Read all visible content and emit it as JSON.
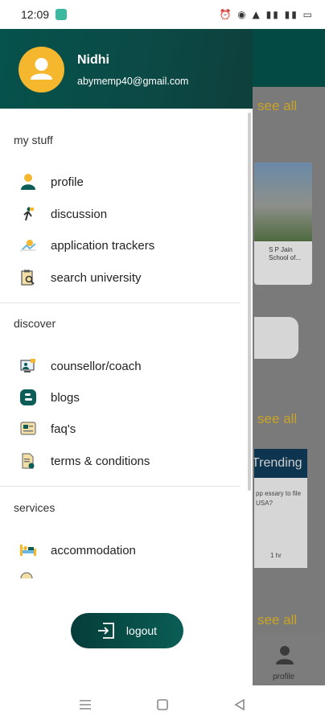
{
  "status_bar": {
    "time": "12:09",
    "right_icons": "⏰ ◉ ▲ ▮▮ ▮▮ ▭"
  },
  "background": {
    "see_all_label": "see all",
    "card_text": "S P Jain School of...",
    "trending_label": "Trending",
    "post_text": "pp essary to file USA?",
    "post_time": "1 hr",
    "nav_profile_label": "profile"
  },
  "user": {
    "name": "Nidhi",
    "email": "abymemp40@gmail.com"
  },
  "sections": {
    "my_stuff": "my stuff",
    "discover": "discover",
    "services": "services"
  },
  "menu": {
    "profile": "profile",
    "discussion": "discussion",
    "application_trackers": "application trackers",
    "search_university": "search university",
    "counsellor_coach": "counsellor/coach",
    "blogs": "blogs",
    "faqs": "faq's",
    "terms_conditions": "terms & conditions",
    "accommodation": "accommodation"
  },
  "logout_label": "logout",
  "colors": {
    "accent_teal": "#0b4a46",
    "avatar_yellow": "#f5b72d",
    "see_all_gold": "#c9a326"
  }
}
